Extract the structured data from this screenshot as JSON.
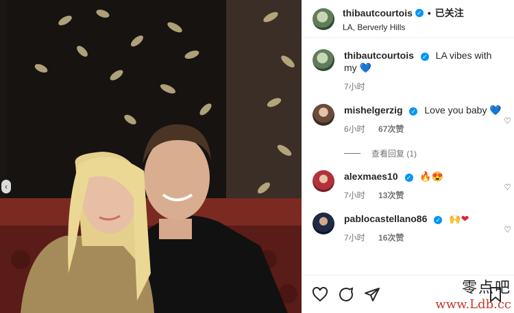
{
  "post": {
    "image_alt": "",
    "slide_prev_label": "‹"
  },
  "header": {
    "username": "thibautcourtois",
    "verified_mark": "✓",
    "separator": "•",
    "follow_status": "已关注",
    "location": "LA, Berverly Hills"
  },
  "comments": [
    {
      "username": "thibautcourtois",
      "text": "LA vibes with my",
      "emoji": "💙",
      "time": "7小时",
      "likes": "",
      "reply": ""
    },
    {
      "username": "mishelgerzig",
      "text": "Love you baby",
      "emoji": "💙",
      "time": "6小时",
      "likes": "67次赞",
      "reply": ""
    },
    {
      "username": "alexmaes10",
      "text": "",
      "emoji": "🔥😍",
      "time": "7小时",
      "likes": "13次赞",
      "reply": ""
    },
    {
      "username": "pablocastellano86",
      "text": "",
      "emoji": "🙌❤",
      "time": "7小时",
      "likes": "16次赞",
      "reply": ""
    }
  ],
  "view_replies": "查看回复 (1)",
  "actions": {
    "like": "like",
    "comment": "comment",
    "share": "share",
    "save": "save"
  },
  "watermark": {
    "line1": "零点吧",
    "line2": "www.Ldb.cc"
  },
  "colors": {
    "verified": "#0095f6",
    "text": "#262626",
    "muted": "#737373"
  }
}
